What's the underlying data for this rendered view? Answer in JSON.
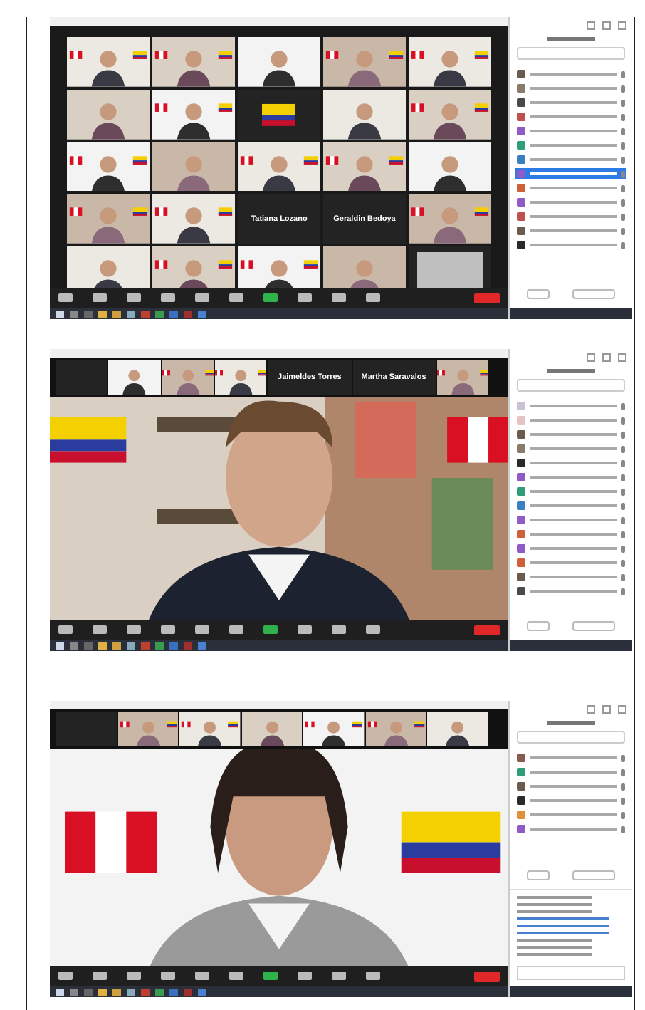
{
  "shots": [
    {
      "kind": "gallery",
      "tiles": [
        {
          "kind": "video"
        },
        {
          "kind": "video"
        },
        {
          "kind": "video"
        },
        {
          "kind": "video"
        },
        {
          "kind": "video"
        },
        {
          "kind": "video"
        },
        {
          "kind": "video"
        },
        {
          "kind": "flag"
        },
        {
          "kind": "video"
        },
        {
          "kind": "video"
        },
        {
          "kind": "video"
        },
        {
          "kind": "video"
        },
        {
          "kind": "video"
        },
        {
          "kind": "video"
        },
        {
          "kind": "video"
        },
        {
          "kind": "video"
        },
        {
          "kind": "video"
        },
        {
          "kind": "name",
          "name": "Tatiana Lozano"
        },
        {
          "kind": "name",
          "name": "Geraldin Bedoya"
        },
        {
          "kind": "video"
        },
        {
          "kind": "video"
        },
        {
          "kind": "video"
        },
        {
          "kind": "video"
        },
        {
          "kind": "video"
        },
        {
          "kind": "blank"
        }
      ],
      "panel": {
        "chat": false,
        "avatars": [
          {
            "color": "#6b5a4e",
            "selected": false
          },
          {
            "color": "#8a7a6a",
            "selected": false
          },
          {
            "color": "#4a4a4a",
            "selected": false
          },
          {
            "color": "#c0504d",
            "selected": false
          },
          {
            "color": "#8e5bc9",
            "selected": false
          },
          {
            "color": "#2e9e7a",
            "selected": false
          },
          {
            "color": "#3a7fc1",
            "selected": false
          },
          {
            "color": "#8e5bc9",
            "selected": true
          },
          {
            "color": "#d0603a",
            "selected": false
          },
          {
            "color": "#8e5bc9",
            "selected": false
          },
          {
            "color": "#c0504d",
            "selected": false
          },
          {
            "color": "#6b5a4e",
            "selected": false
          },
          {
            "color": "#2a2a2a",
            "selected": false
          }
        ]
      }
    },
    {
      "kind": "speaker",
      "strip": [
        {
          "kind": "empty"
        },
        {
          "kind": "video"
        },
        {
          "kind": "video"
        },
        {
          "kind": "video"
        },
        {
          "kind": "name",
          "name": "Jaimeldes Torres"
        },
        {
          "kind": "name",
          "name": "Martha Saravalos"
        },
        {
          "kind": "video"
        }
      ],
      "panel": {
        "chat": false,
        "avatars": [
          {
            "color": "#c9c2d6",
            "selected": false
          },
          {
            "color": "#e6c4c4",
            "selected": false
          },
          {
            "color": "#6b5a4e",
            "selected": false
          },
          {
            "color": "#8a7a6a",
            "selected": false
          },
          {
            "color": "#2a2a2a",
            "selected": false
          },
          {
            "color": "#8e5bc9",
            "selected": false
          },
          {
            "color": "#2e9e7a",
            "selected": false
          },
          {
            "color": "#3a7fc1",
            "selected": false
          },
          {
            "color": "#8e5bc9",
            "selected": false
          },
          {
            "color": "#d0603a",
            "selected": false
          },
          {
            "color": "#8e5bc9",
            "selected": false
          },
          {
            "color": "#d0603a",
            "selected": false
          },
          {
            "color": "#6b5a4e",
            "selected": false
          },
          {
            "color": "#4a4a4a",
            "selected": false
          }
        ]
      }
    },
    {
      "kind": "speaker",
      "strip": [
        {
          "kind": "empty"
        },
        {
          "kind": "video"
        },
        {
          "kind": "video"
        },
        {
          "kind": "video"
        },
        {
          "kind": "video"
        },
        {
          "kind": "video"
        },
        {
          "kind": "video"
        }
      ],
      "panel": {
        "chat": true,
        "avatars": [
          {
            "color": "#8a5a4e",
            "selected": false
          },
          {
            "color": "#2e9e7a",
            "selected": false
          },
          {
            "color": "#6b5a4e",
            "selected": false
          },
          {
            "color": "#2a2a2a",
            "selected": false
          },
          {
            "color": "#e0903a",
            "selected": false
          },
          {
            "color": "#8e5bc9",
            "selected": false
          }
        ]
      }
    }
  ]
}
